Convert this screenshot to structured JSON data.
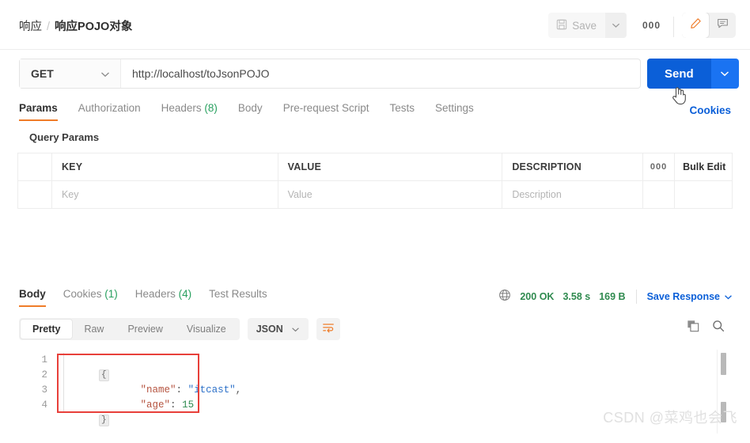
{
  "header": {
    "breadcrumb_parent": "响应",
    "breadcrumb_separator": "/",
    "breadcrumb_current": "响应POJO对象",
    "save_label": "Save",
    "save_caret_icon": "chevron-down-icon",
    "more_label": "000",
    "edit_icon": "pencil-icon",
    "comment_icon": "comment-icon"
  },
  "request": {
    "method": "GET",
    "method_caret_icon": "chevron-down-icon",
    "url": "http://localhost/toJsonPOJO",
    "send_label": "Send",
    "send_caret_icon": "chevron-down-icon",
    "cookies_label": "Cookies",
    "cursor_icon": "hand-pointer-cursor",
    "tabs": [
      {
        "label": "Params",
        "count": "",
        "active": true
      },
      {
        "label": "Authorization",
        "count": "",
        "active": false
      },
      {
        "label": "Headers",
        "count": "(8)",
        "active": false
      },
      {
        "label": "Body",
        "count": "",
        "active": false
      },
      {
        "label": "Pre-request Script",
        "count": "",
        "active": false
      },
      {
        "label": "Tests",
        "count": "",
        "active": false
      },
      {
        "label": "Settings",
        "count": "",
        "active": false
      }
    ],
    "query_params_title": "Query Params",
    "table": {
      "headers": {
        "key": "KEY",
        "value": "VALUE",
        "description": "DESCRIPTION",
        "dots": "000",
        "bulk_edit": "Bulk Edit"
      },
      "placeholder_row": {
        "key": "Key",
        "value": "Value",
        "description": "Description"
      }
    }
  },
  "response": {
    "tabs": [
      {
        "label": "Body",
        "count": "",
        "active": true
      },
      {
        "label": "Cookies",
        "count": "(1)",
        "active": false
      },
      {
        "label": "Headers",
        "count": "(4)",
        "active": false
      },
      {
        "label": "Test Results",
        "count": "",
        "active": false
      }
    ],
    "globe_icon": "globe-icon",
    "status": "200 OK",
    "time": "3.58 s",
    "size": "169 B",
    "save_response_label": "Save Response",
    "save_response_caret_icon": "chevron-down-icon",
    "viewer": {
      "modes": [
        {
          "label": "Pretty",
          "active": true
        },
        {
          "label": "Raw",
          "active": false
        },
        {
          "label": "Preview",
          "active": false
        },
        {
          "label": "Visualize",
          "active": false
        }
      ],
      "format": "JSON",
      "format_caret_icon": "chevron-down-icon",
      "wrap_icon": "wrap-lines-icon",
      "copy_icon": "copy-icon",
      "search_icon": "search-icon"
    },
    "code": {
      "line_numbers": [
        "1",
        "2",
        "3",
        "4"
      ],
      "lines": [
        {
          "open_brace": "{"
        },
        {
          "key": "\"name\"",
          "colon": ": ",
          "value": "\"itcast\"",
          "comma": ","
        },
        {
          "key": "\"age\"",
          "colon": ": ",
          "value": "15",
          "comma": ""
        },
        {
          "close_brace": "}"
        }
      ],
      "raw_text": "{\n    \"name\": \"itcast\",\n    \"age\": 15\n}"
    }
  },
  "watermark": "CSDN @菜鸡也会飞",
  "colors": {
    "accent_orange": "#ef7c29",
    "link_blue": "#0b5fd8",
    "send_blue": "#0b5fd8",
    "status_green": "#2f8a4f",
    "annotation_red": "#e8403a"
  }
}
